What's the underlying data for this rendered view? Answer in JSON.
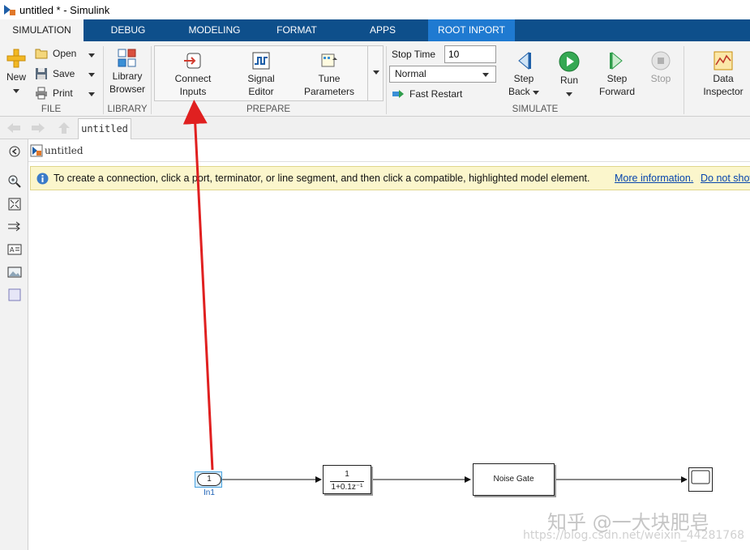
{
  "window": {
    "title": "untitled * - Simulink"
  },
  "tabs": [
    {
      "label": "SIMULATION",
      "active": true
    },
    {
      "label": "DEBUG"
    },
    {
      "label": "MODELING"
    },
    {
      "label": "FORMAT"
    },
    {
      "label": "APPS"
    },
    {
      "label": "ROOT INPORT",
      "contextual": true
    }
  ],
  "ribbon": {
    "file": {
      "group_label": "FILE",
      "new_label": "New",
      "open_label": "Open",
      "save_label": "Save",
      "print_label": "Print"
    },
    "library": {
      "group_label": "LIBRARY",
      "library_browser_line1": "Library",
      "library_browser_line2": "Browser"
    },
    "prepare": {
      "group_label": "PREPARE",
      "connect_line1": "Connect",
      "connect_line2": "Inputs",
      "signal_line1": "Signal",
      "signal_line2": "Editor",
      "tune_line1": "Tune",
      "tune_line2": "Parameters"
    },
    "simulate": {
      "group_label": "SIMULATE",
      "stop_time_label": "Stop Time",
      "stop_time_value": "10",
      "mode_value": "Normal",
      "fast_restart_label": "Fast Restart",
      "step_back_line1": "Step",
      "step_back_line2": "Back",
      "run_label": "Run",
      "step_forward_line1": "Step",
      "step_forward_line2": "Forward",
      "stop_label": "Stop"
    },
    "review": {
      "data_inspector_line1": "Data",
      "data_inspector_line2": "Inspector"
    }
  },
  "nav": {
    "model_tab_label": "untitled"
  },
  "canvas": {
    "breadcrumb_label": "untitled",
    "info_message": "To create a connection, click a port, terminator, or line segment, and then click a compatible, highlighted model element.",
    "info_more_link": "More information.",
    "info_dismiss_link": "Do not show"
  },
  "model": {
    "inport_number": "1",
    "inport_name": "In1",
    "tf_numerator": "1",
    "tf_denominator": "1+0.1z⁻¹",
    "noise_gate_label": "Noise Gate"
  },
  "watermark": {
    "cn": "知乎 @一大块肥皂",
    "url": "https://blog.csdn.net/weixin_44281768"
  },
  "colors": {
    "tab_bar": "#0e4f8b",
    "contextual_tab": "#1f7ad1",
    "annotation_arrow": "#e02020",
    "info_bar": "#fbf6cc"
  }
}
